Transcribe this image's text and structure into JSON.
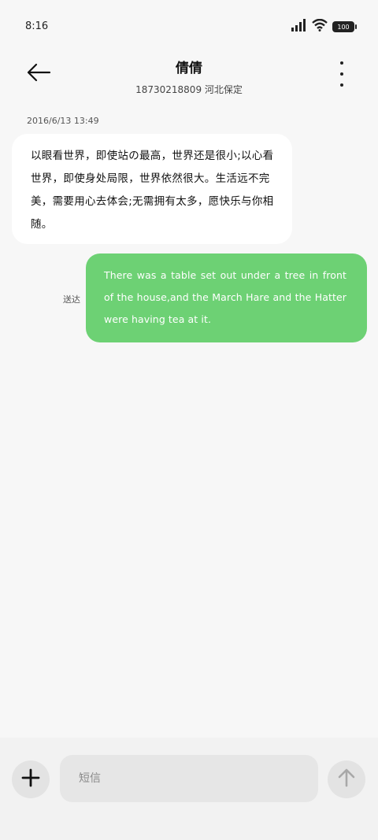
{
  "status_bar": {
    "time": "8:16",
    "battery": "100",
    "icons": [
      "signal-icon",
      "wifi-icon",
      "battery-icon"
    ]
  },
  "header": {
    "contact_name": "倩倩",
    "contact_subtitle": "18730218809  河北保定",
    "icons": [
      "back-arrow-icon",
      "more-vertical-icon"
    ]
  },
  "conversation": {
    "timestamp": "2016/6/13  13:49",
    "received_message": "以眼看世界，即使站の最高，世界还是很小;以心看世界，即使身处局限，世界依然很大。生活远不完美，需要用心去体会;无需拥有太多，愿快乐与你相随。",
    "sent_message": "There was a table set out under a tree in front of the house,and the March Hare and the Hatter were having tea at it.",
    "sent_status": "送达"
  },
  "composer": {
    "placeholder": "短信",
    "value": "",
    "icons": [
      "plus-icon",
      "send-arrow-icon"
    ]
  },
  "colors": {
    "background": "#f7f7f7",
    "sent_bubble": "#6dd174",
    "received_bubble": "#ffffff",
    "composer_button": "#e3e3e3"
  }
}
